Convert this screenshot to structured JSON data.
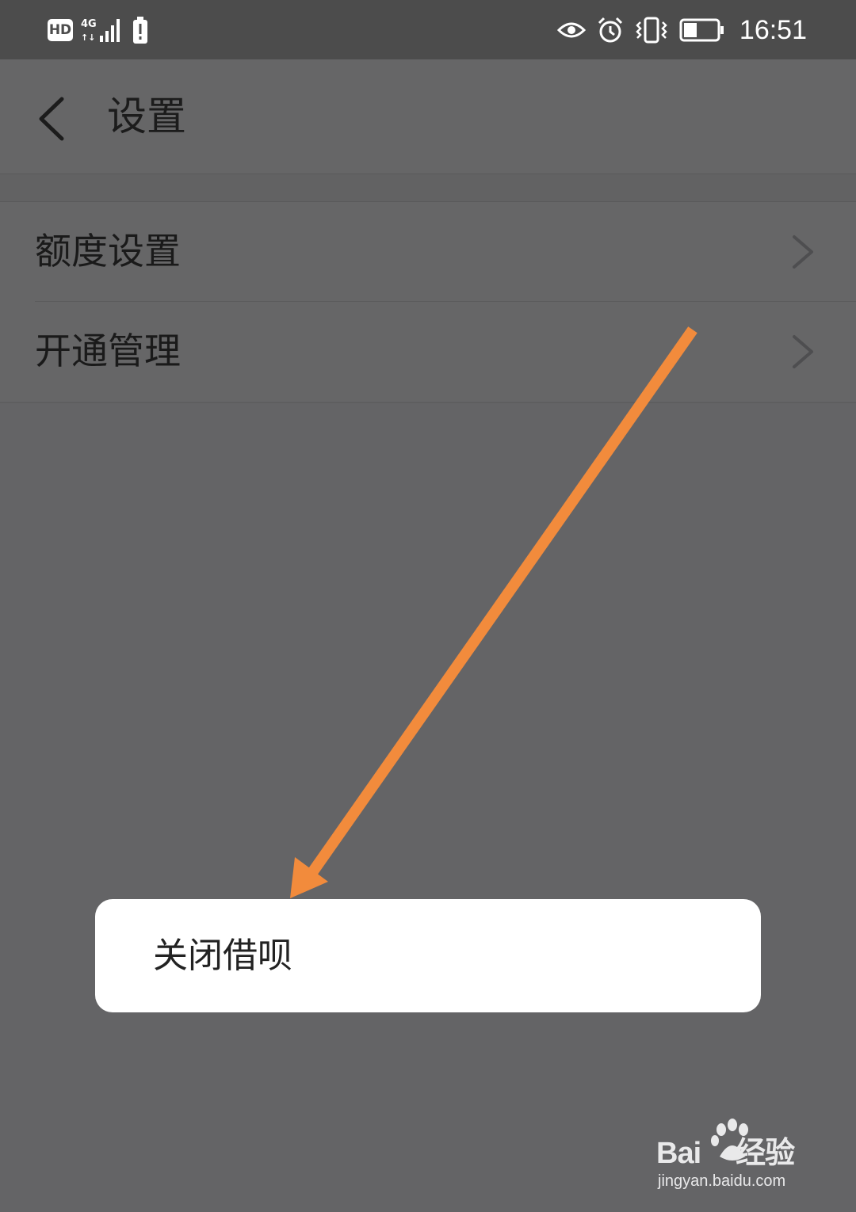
{
  "status_bar": {
    "network_badge": "HD",
    "network_type": "4G",
    "time": "16:51",
    "icons": [
      "hd-icon",
      "signal-4g-icon",
      "battery-alert-icon",
      "eye-icon",
      "alarm-icon",
      "vibrate-icon",
      "battery-icon"
    ]
  },
  "header": {
    "title": "设置",
    "back_icon": "chevron-left-icon"
  },
  "menu": {
    "items": [
      {
        "label": "额度设置",
        "icon": "chevron-right-icon"
      },
      {
        "label": "开通管理",
        "icon": "chevron-right-icon"
      }
    ]
  },
  "popup": {
    "option_label": "关闭借呗"
  },
  "annotation": {
    "arrow_color": "#f28b3c",
    "icon": "arrow-annotation"
  },
  "watermark": {
    "brand_left": "Bai",
    "brand_right": "经验",
    "url": "jingyan.baidu.com"
  },
  "colors": {
    "status_bar_bg": "#4c4c4c",
    "screen_bg": "#646466",
    "popup_bg": "#ffffff"
  }
}
